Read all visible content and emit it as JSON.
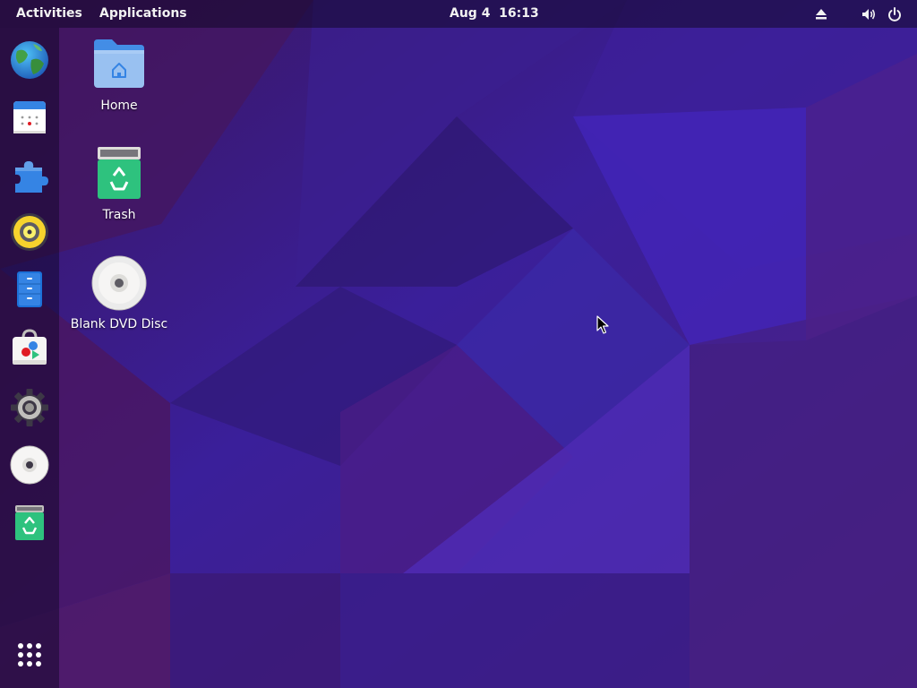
{
  "topbar": {
    "activities": "Activities",
    "applications": "Applications",
    "clock": "Aug 4  16:13",
    "indicators": [
      "eject-icon",
      "volume-icon",
      "power-icon"
    ]
  },
  "dock": {
    "items": [
      {
        "name": "web-browser",
        "icon": "globe-icon"
      },
      {
        "name": "calendar",
        "icon": "calendar-icon"
      },
      {
        "name": "extensions",
        "icon": "puzzle-piece-icon"
      },
      {
        "name": "music-player",
        "icon": "speaker-icon"
      },
      {
        "name": "file-manager",
        "icon": "file-cabinet-icon"
      },
      {
        "name": "software-store",
        "icon": "shopping-bag-icon"
      },
      {
        "name": "settings",
        "icon": "gear-icon"
      },
      {
        "name": "dvd-disc",
        "icon": "disc-icon"
      },
      {
        "name": "trash",
        "icon": "trash-icon"
      },
      {
        "name": "show-apps",
        "icon": "app-grid-icon"
      }
    ]
  },
  "desktop": {
    "icons": [
      {
        "label": "Home",
        "icon": "home-folder-icon"
      },
      {
        "label": "Trash",
        "icon": "trash-icon"
      },
      {
        "label": "Blank DVD Disc",
        "icon": "disc-icon"
      }
    ]
  },
  "colors": {
    "wallpaper_base": "#3a1a78",
    "wallpaper_accent": "#4a2fd8",
    "topbar_text": "#f2f2f2"
  }
}
